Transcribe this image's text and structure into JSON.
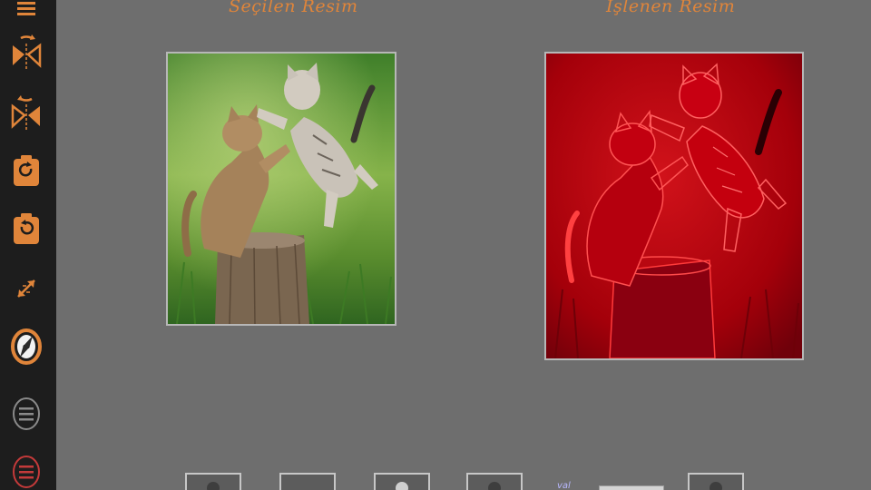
{
  "panels": {
    "selected_title": "Seçilen Resim",
    "processed_title": "İşlenen Resim"
  },
  "toolbar": {
    "items": [
      {
        "name": "menu-icon"
      },
      {
        "name": "flip-horizontal-icon"
      },
      {
        "name": "flip-vertical-icon"
      },
      {
        "name": "rotate-right-icon"
      },
      {
        "name": "rotate-left-icon"
      },
      {
        "name": "resize-icon"
      },
      {
        "name": "compass-icon"
      },
      {
        "name": "list-circle-icon"
      },
      {
        "name": "list-circle-red-icon"
      }
    ]
  },
  "bottom_bar": {
    "slider_label": "val"
  },
  "colors": {
    "accent": "#e0853a",
    "sidebar_bg": "#1d1d1d",
    "canvas_bg": "#6e6e6e",
    "processed_tint": "#c4000c"
  }
}
